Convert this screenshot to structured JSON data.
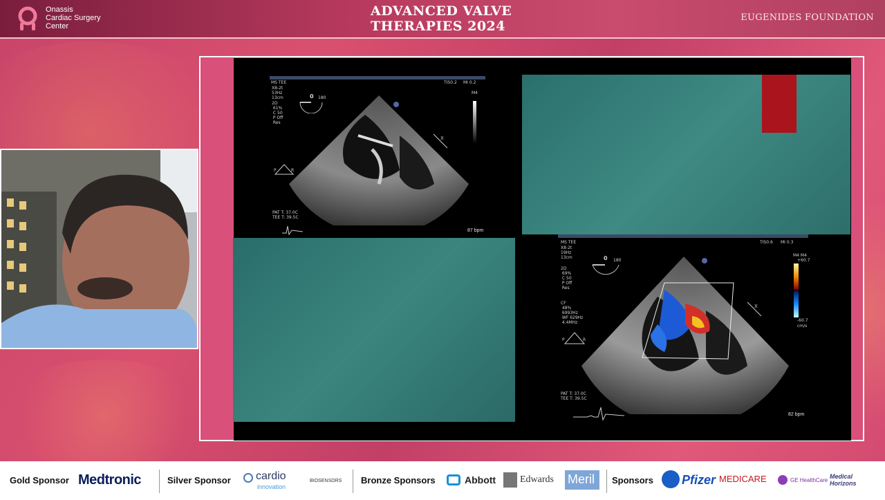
{
  "header": {
    "org_name_1": "Onassis",
    "org_name_2": "Cardiac Surgery",
    "org_name_3": "Center",
    "title_line_1": "ADVANCED VALVE",
    "title_line_2": "THERAPIES 2024",
    "foundation": "EUGENIDES FOUNDATION"
  },
  "echo_top_left": {
    "label": "MS TEE",
    "tis": "TIS0.2",
    "mi": "MI 0.2",
    "params": "X8-2t\n53Hz\n13cm",
    "mode": "2D\n 61%\n C 50\n P Off\n Res",
    "angle": "0",
    "angle_max": "180",
    "map": "M4",
    "temp": "PAT T: 37.0C\nTEE T: 39.5C",
    "bpm": "87 bpm"
  },
  "echo_bottom_right": {
    "label": "MS TEE",
    "tis": "TIS0.6",
    "mi": "MI 0.3",
    "params": "X8-2t\n19Hz\n13cm",
    "mode": "2D\n 69%\n C 50\n P Off\n Res",
    "cf": "CF\n 48%\n 6993Hz\n WF 629Hz\n 4.4MHz",
    "angle": "0",
    "angle_max": "180",
    "map": "M4 M4",
    "scale_top": "+60.7",
    "scale_bottom": "-60.7",
    "scale_unit": "cm/s",
    "temp": "PAT T: 37.0C\nTEE T: 39.5C",
    "bpm": "82 bpm"
  },
  "sponsors": {
    "gold_label": "Gold Sponsor",
    "gold_1": "Medtronic",
    "silver_label": "Silver Sponsor",
    "silver_1": "cardio",
    "silver_1b": "innovation",
    "silver_2": "BIOSENSORS",
    "bronze_label": "Bronze Sponsors",
    "bronze_1": "Abbott",
    "bronze_2": "Edwards",
    "bronze_3": "Meril",
    "sponsors_label": "Sponsors",
    "sp_1": "Pfizer",
    "sp_2": "MEDICARE",
    "sp_3": "GE HealthCare",
    "sp_4": "Medical Horizons"
  },
  "colors": {
    "header_bg": "#9d2f52",
    "background": "#d24a70",
    "accent_red": "#a9141d",
    "teal": "#2f7572"
  }
}
